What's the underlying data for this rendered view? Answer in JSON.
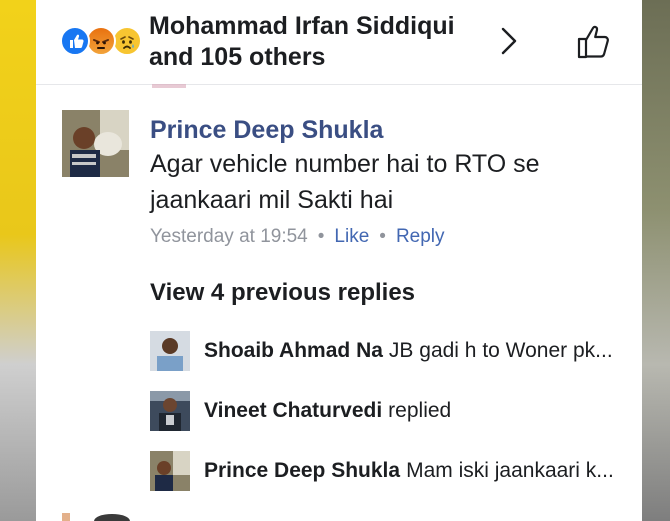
{
  "header": {
    "title": "Mohammad Irfan Siddiqui and 105 others",
    "reactions": [
      "like-reaction",
      "angry-reaction",
      "sad-reaction"
    ],
    "chevron_icon": "chevron-right-icon",
    "action_icon": "thumbs-up-icon"
  },
  "comment": {
    "author": "Prince Deep Shukla",
    "text": "Agar vehicle number hai to RTO se jaankaari mil Sakti hai",
    "timestamp": "Yesterday at 19:54",
    "like_label": "Like",
    "reply_label": "Reply"
  },
  "view_previous": "View 4 previous replies",
  "replies": [
    {
      "name": "Shoaib Ahmad Na",
      "text": "JB gadi h to Woner pk..."
    },
    {
      "name": "Vineet Chaturvedi",
      "text": "replied"
    },
    {
      "name": "Prince Deep Shukla",
      "text": "Mam iski jaankaari k..."
    }
  ],
  "colors": {
    "name_blue": "#3a4e83",
    "action_blue": "#4267b2",
    "meta_gray": "#90949c",
    "like_blue": "#1877f2"
  }
}
